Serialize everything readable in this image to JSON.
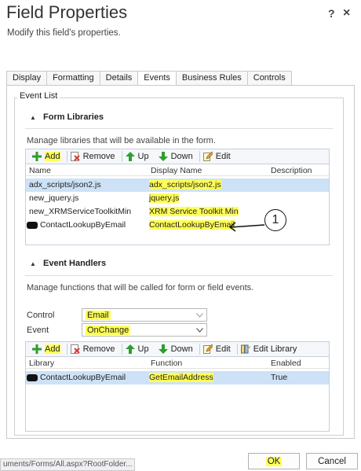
{
  "dialog": {
    "title": "Field Properties",
    "subtitle": "Modify this field's properties.",
    "help_glyph": "?",
    "close_glyph": "×"
  },
  "tabs": [
    {
      "label": "Display"
    },
    {
      "label": "Formatting"
    },
    {
      "label": "Details"
    },
    {
      "label": "Events",
      "active": true
    },
    {
      "label": "Business Rules"
    },
    {
      "label": "Controls"
    }
  ],
  "event_list": {
    "legend": "Event List",
    "form_libraries": {
      "header": "Form Libraries",
      "description": "Manage libraries that will be available in the form.",
      "toolbar": {
        "add": "Add",
        "remove": "Remove",
        "up": "Up",
        "down": "Down",
        "edit": "Edit"
      },
      "columns": {
        "name": "Name",
        "display_name": "Display Name",
        "description": "Description"
      },
      "rows": [
        {
          "name": "adx_scripts/json2.js",
          "display_name": "adx_scripts/json2.js",
          "description": ""
        },
        {
          "name": "new_jquery.js",
          "display_name": "jquery.js",
          "description": ""
        },
        {
          "name": "new_XRMServiceToolkitMin",
          "display_name": "XRM Service Toolkit Min",
          "description": ""
        },
        {
          "name": "ContactLookupByEmail",
          "display_name": "ContactLookupByEmail",
          "description": ""
        }
      ]
    },
    "event_handlers": {
      "header": "Event Handlers",
      "description": "Manage functions that will be called for form or field events.",
      "control_label": "Control",
      "control_value": "Email",
      "event_label": "Event",
      "event_value": "OnChange",
      "toolbar": {
        "add": "Add",
        "remove": "Remove",
        "up": "Up",
        "down": "Down",
        "edit": "Edit",
        "edit_library": "Edit Library"
      },
      "columns": {
        "library": "Library",
        "function": "Function",
        "enabled": "Enabled"
      },
      "rows": [
        {
          "library": "ContactLookupByEmail",
          "function": "GetEmailAddress",
          "enabled": "True"
        }
      ]
    }
  },
  "annotation": "1",
  "status_url": "uments/Forms/All.aspx?RootFolder...",
  "buttons": {
    "ok": "OK",
    "cancel": "Cancel"
  },
  "colors": {
    "highlight": "#ffff55",
    "selected_row": "#cde2f6",
    "add_icon": "#2e9e2e",
    "remove_icon": "#d63a2e"
  }
}
